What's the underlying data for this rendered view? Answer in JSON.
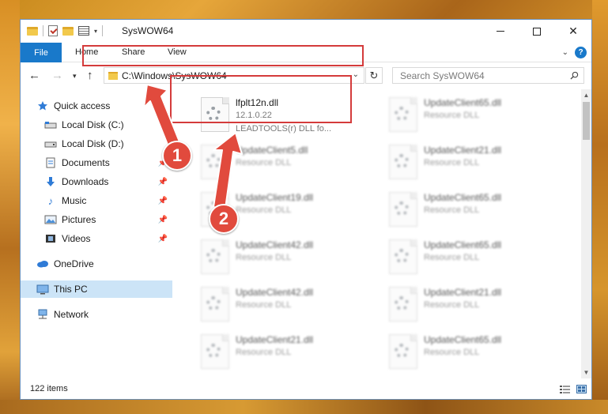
{
  "window": {
    "title": "SysWOW64"
  },
  "ribbon": {
    "tabs": [
      "File",
      "Home",
      "Share",
      "View"
    ],
    "help_label": "?"
  },
  "navigation": {
    "address": "C:\\Windows\\SysWOW64",
    "search_placeholder": "Search SysWOW64"
  },
  "sidebar": {
    "items": [
      {
        "label": "Quick access",
        "icon": "star-icon"
      },
      {
        "label": "Local Disk (C:)",
        "icon": "drive-icon"
      },
      {
        "label": "Local Disk (D:)",
        "icon": "drive-icon"
      },
      {
        "label": "Documents",
        "icon": "documents-icon"
      },
      {
        "label": "Downloads",
        "icon": "download-icon"
      },
      {
        "label": "Music",
        "icon": "music-icon"
      },
      {
        "label": "Pictures",
        "icon": "pictures-icon"
      },
      {
        "label": "Videos",
        "icon": "videos-icon"
      },
      {
        "label": "OneDrive",
        "icon": "cloud-icon"
      },
      {
        "label": "This PC",
        "icon": "computer-icon"
      },
      {
        "label": "Network",
        "icon": "network-icon"
      }
    ],
    "selected": "This PC"
  },
  "files": {
    "highlighted": {
      "name": "lfplt12n.dll",
      "version": "12.1.0.22",
      "description": "LEADTOOLS(r) DLL fo..."
    },
    "others": [
      {
        "name": "UpdateClient65.dll",
        "type": "Resource DLL"
      },
      {
        "name": "UpdateClient5.dll",
        "type": "Resource DLL"
      },
      {
        "name": "UpdateClient21.dll",
        "type": "Resource DLL"
      },
      {
        "name": "UpdateClient19.dll",
        "type": "Resource DLL"
      },
      {
        "name": "UpdateClient65.dll",
        "type": "Resource DLL"
      },
      {
        "name": "UpdateClient42.dll",
        "type": "Resource DLL"
      },
      {
        "name": "UpdateClient65.dll",
        "type": "Resource DLL"
      },
      {
        "name": "UpdateClient42.dll",
        "type": "Resource DLL"
      },
      {
        "name": "UpdateClient21.dll",
        "type": "Resource DLL"
      },
      {
        "name": "UpdateClient21.dll",
        "type": "Resource DLL"
      },
      {
        "name": "UpdateClient65.dll",
        "type": "Resource DLL"
      }
    ]
  },
  "status": {
    "item_count": "122 items"
  },
  "callouts": [
    "1",
    "2"
  ],
  "colors": {
    "accent": "#1979ca",
    "highlight": "#d43b3b",
    "callout": "#e14a3d",
    "selected": "#cce4f7"
  }
}
